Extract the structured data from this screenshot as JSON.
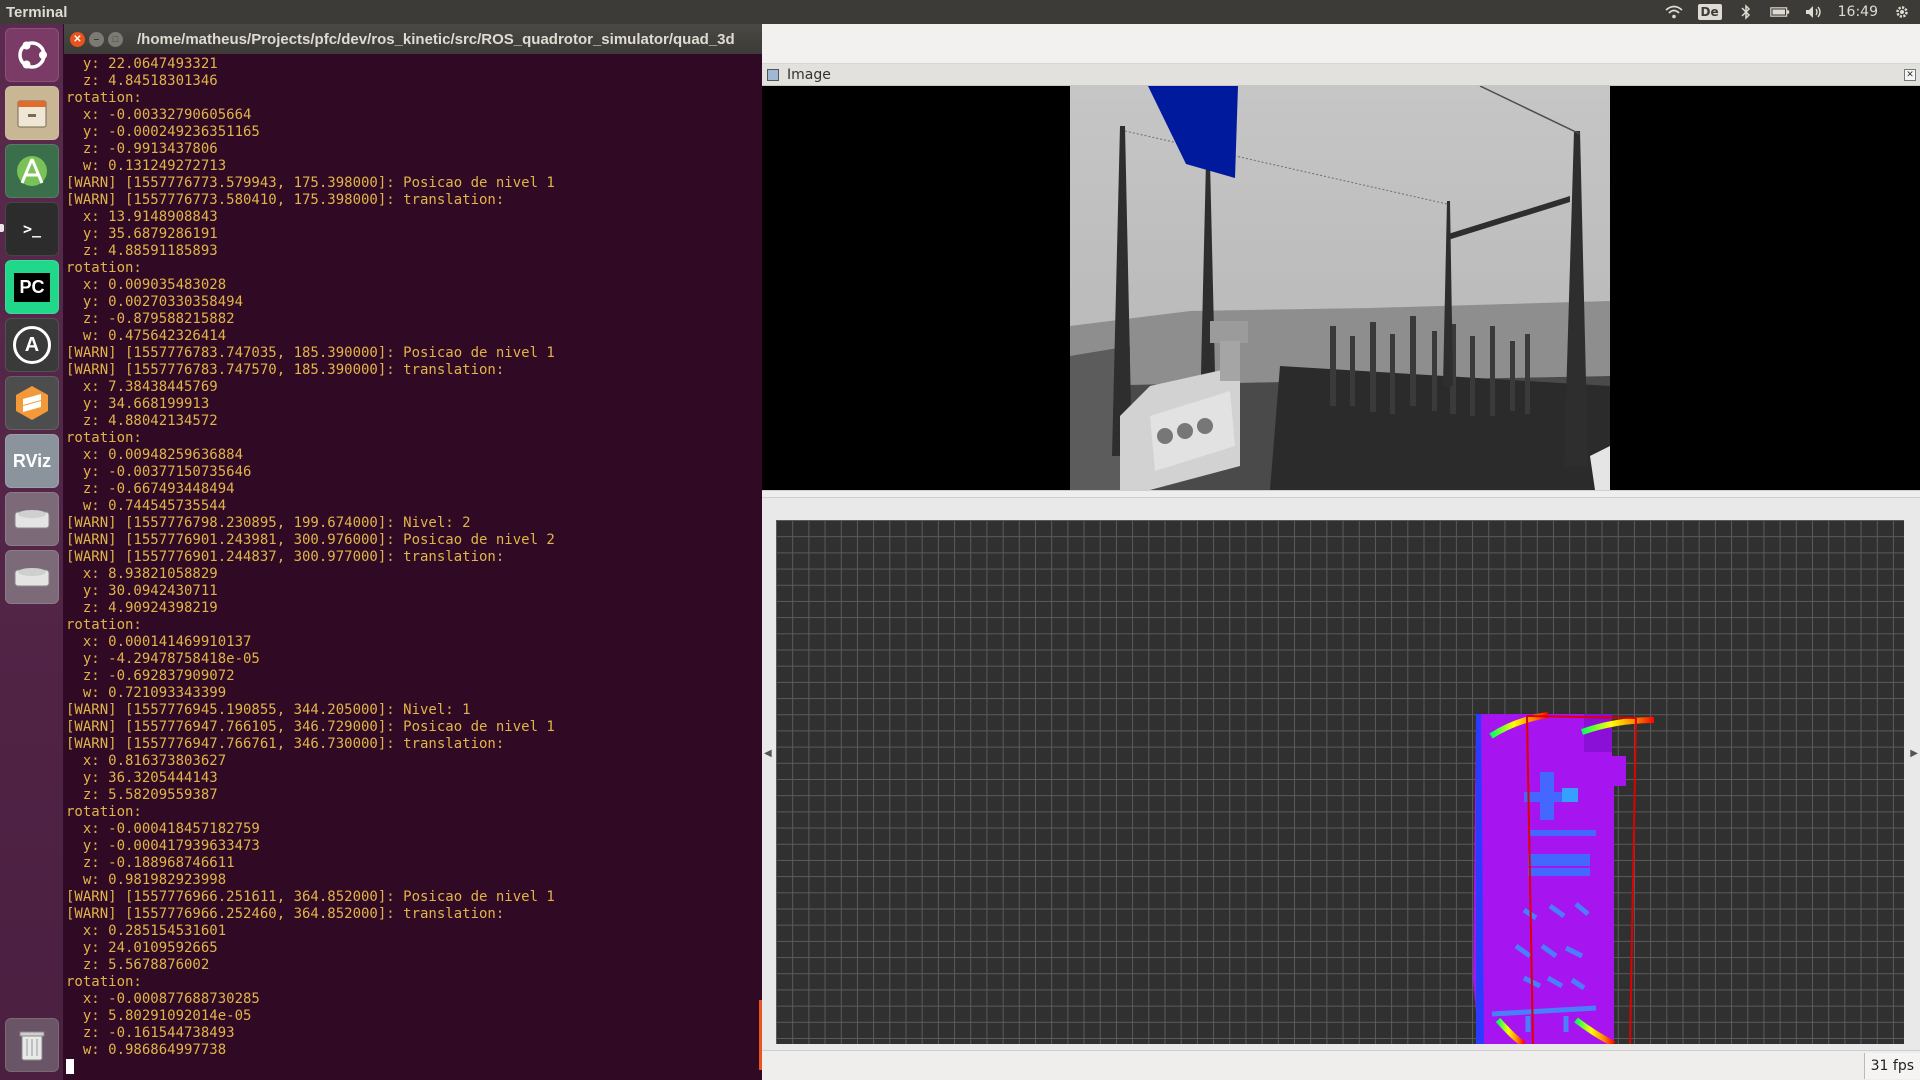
{
  "top_panel": {
    "app_title": "Terminal",
    "keyboard_layout": "De",
    "clock": "16:49",
    "icons": [
      "wifi-icon",
      "bluetooth-icon",
      "battery-icon",
      "volume-icon",
      "settings-gear-icon"
    ]
  },
  "launcher": {
    "items": [
      {
        "name": "ubuntu-dash",
        "label": "",
        "color": "#e8d0de"
      },
      {
        "name": "files",
        "label": "",
        "color": "#c7b7a0"
      },
      {
        "name": "android-studio",
        "label": "",
        "color": "#7cc35e"
      },
      {
        "name": "terminal",
        "label": ">_",
        "color": "#2c2c2c"
      },
      {
        "name": "pycharm",
        "label": "PC",
        "color": "#1ed760"
      },
      {
        "name": "software-updater",
        "label": "A",
        "color": "#3a3a3a"
      },
      {
        "name": "sublime-text",
        "label": "",
        "color": "#f0902f"
      },
      {
        "name": "rviz",
        "label": "RViz",
        "color": "#9aa3ab"
      },
      {
        "name": "drive-1",
        "label": "",
        "color": "#cfcfcf"
      },
      {
        "name": "drive-2",
        "label": "",
        "color": "#cfcfcf"
      },
      {
        "name": "trash",
        "label": "",
        "color": "#d6d6d6"
      }
    ]
  },
  "terminal": {
    "title": "/home/matheus/Projects/pfc/dev/ros_kinetic/src/ROS_quadrotor_simulator/quad_3d",
    "lines": [
      "  y: 22.0647493321",
      "  z: 4.84518301346",
      "rotation: ",
      "  x: -0.00332790605664",
      "  y: -0.000249236351165",
      "  z: -0.9913437806",
      "  w: 0.131249272713",
      "[WARN] [1557776773.579943, 175.398000]: Posicao de nivel 1",
      "[WARN] [1557776773.580410, 175.398000]: translation: ",
      "  x: 13.9148908843",
      "  y: 35.6879286191",
      "  z: 4.88591185893",
      "rotation: ",
      "  x: 0.009035483028",
      "  y: 0.00270330358494",
      "  z: -0.879588215882",
      "  w: 0.475642326414",
      "[WARN] [1557776783.747035, 185.390000]: Posicao de nivel 1",
      "[WARN] [1557776783.747570, 185.390000]: translation: ",
      "  x: 7.38438445769",
      "  y: 34.668199913",
      "  z: 4.88042134572",
      "rotation: ",
      "  x: 0.00948259636884",
      "  y: -0.00377150735646",
      "  z: -0.667493448494",
      "  w: 0.744545735544",
      "[WARN] [1557776798.230895, 199.674000]: Nivel: 2",
      "[WARN] [1557776901.243981, 300.976000]: Posicao de nivel 2",
      "[WARN] [1557776901.244837, 300.977000]: translation: ",
      "  x: 8.93821058829",
      "  y: 30.0942430711",
      "  z: 4.90924398219",
      "rotation: ",
      "  x: 0.000141469910137",
      "  y: -4.29478758418e-05",
      "  z: -0.692837909072",
      "  w: 0.721093343399",
      "[WARN] [1557776945.190855, 344.205000]: Nivel: 1",
      "[WARN] [1557776947.766105, 346.729000]: Posicao de nivel 1",
      "[WARN] [1557776947.766761, 346.730000]: translation: ",
      "  x: 0.816373803627",
      "  y: 36.3205444143",
      "  z: 5.58209559387",
      "rotation: ",
      "  x: -0.000418457182759",
      "  y: -0.000417939633473",
      "  z: -0.188968746611",
      "  w: 0.981982923998",
      "[WARN] [1557776966.251611, 364.852000]: Posicao de nivel 1",
      "[WARN] [1557776966.252460, 364.852000]: translation: ",
      "  x: 0.285154531601",
      "  y: 24.0109592665",
      "  z: 5.5678876002",
      "rotation: ",
      "  x: -0.000877688730285",
      "  y: 5.80291092014e-05",
      "  z: -0.161544738493",
      "  w: 0.986864997738"
    ]
  },
  "image_window": {
    "panel_title": "Image",
    "fps": "31 fps"
  },
  "colors": {
    "terminal_bg": "#300a24",
    "terminal_text": "#e0b44a",
    "panel_bg": "#3c3b37",
    "accent_orange": "#e95420",
    "map_bg": "#303030",
    "pointcloud_purple": "#a020f0",
    "bounding_box_red": "#e00000"
  }
}
